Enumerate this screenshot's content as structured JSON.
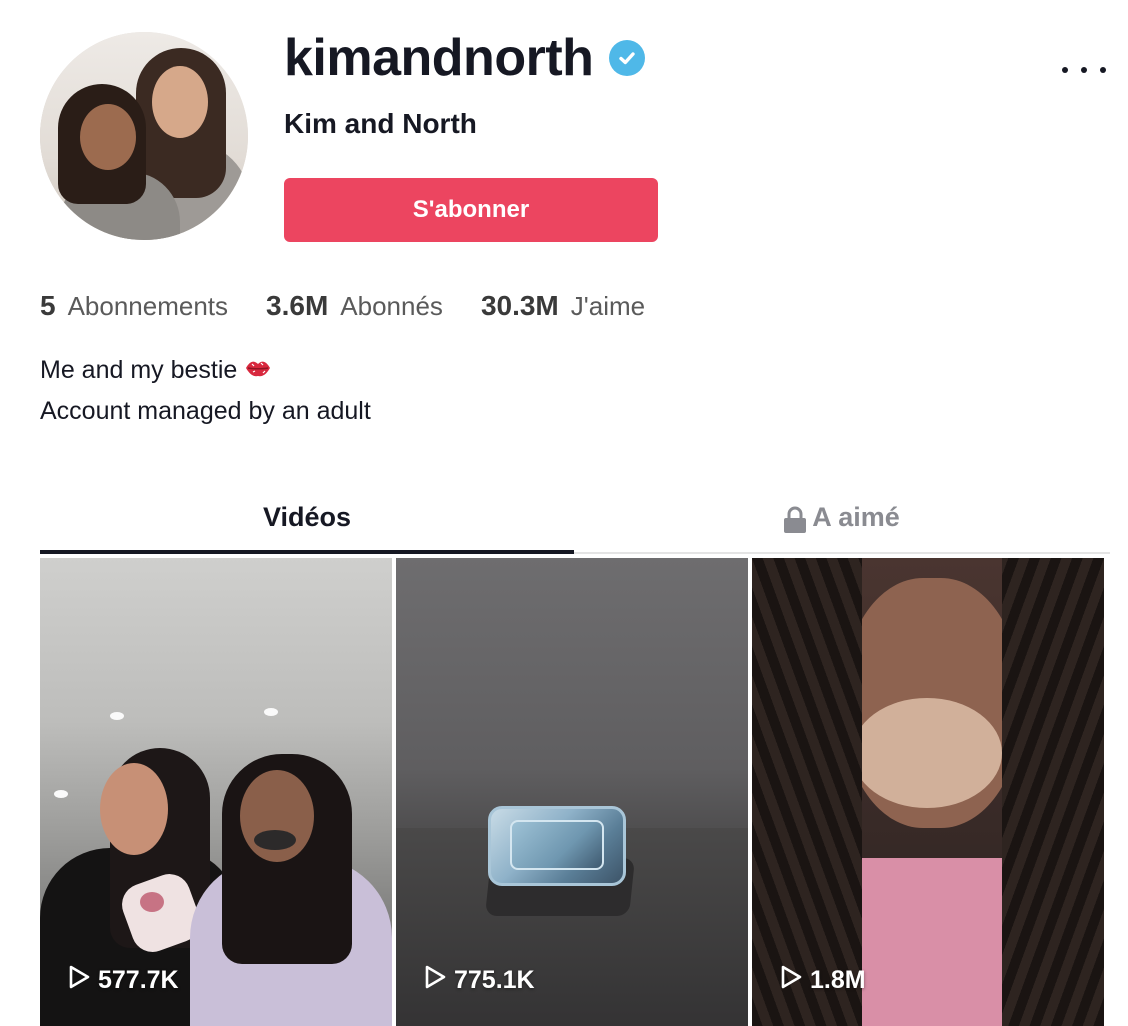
{
  "profile": {
    "username": "kimandnorth",
    "display_name": "Kim and North",
    "follow_label": "S'abonner",
    "verified": true
  },
  "stats": {
    "following": {
      "value": "5",
      "label": "Abonnements"
    },
    "followers": {
      "value": "3.6M",
      "label": "Abonnés"
    },
    "likes": {
      "value": "30.3M",
      "label": "J'aime"
    }
  },
  "bio": {
    "line1": "Me and my bestie",
    "line2": "Account managed by an adult",
    "emoji_icon": "kiss-lips-icon"
  },
  "tabs": {
    "videos": "Vidéos",
    "liked": "A aimé"
  },
  "videos": [
    {
      "views": "577.7K"
    },
    {
      "views": "775.1K"
    },
    {
      "views": "1.8M"
    }
  ],
  "colors": {
    "follow_button": "#ec4560",
    "verified_badge": "#4fb8e8",
    "text_primary": "#161823"
  }
}
